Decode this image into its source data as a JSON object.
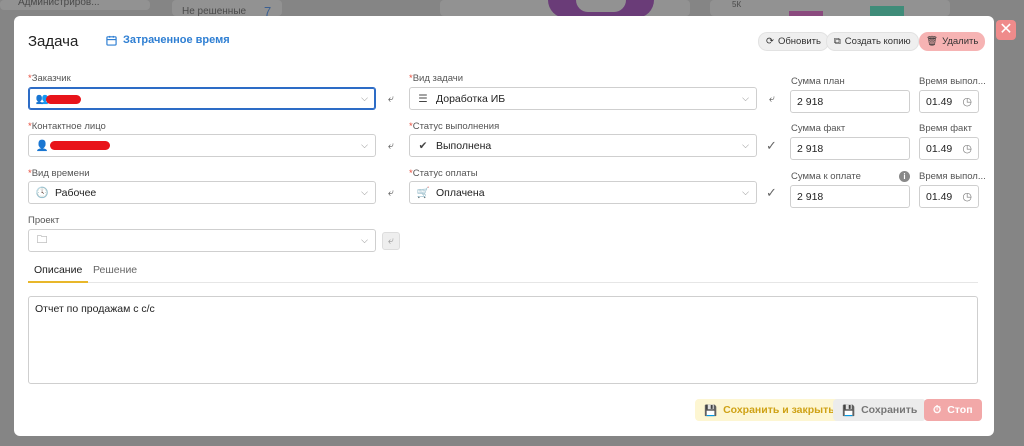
{
  "background": {
    "sidebar_item": "Администриров...",
    "stat_label": "Не решенные",
    "stat_value": "7",
    "chart_tick": "5К"
  },
  "modal": {
    "title": "Задача",
    "time_link": "Затраченное время",
    "buttons": {
      "refresh": "Обновить",
      "copy": "Создать копию",
      "delete": "Удалить"
    }
  },
  "form": {
    "customer": {
      "label": "Заказчик",
      "value": ""
    },
    "contact": {
      "label": "Контактное лицо",
      "value": ""
    },
    "time_type": {
      "label": "Вид времени",
      "value": "Рабочее"
    },
    "project": {
      "label": "Проект",
      "value": ""
    },
    "task_type": {
      "label": "Вид задачи",
      "value": "Доработка ИБ"
    },
    "exec_status": {
      "label": "Статус выполнения",
      "value": "Выполнена"
    },
    "pay_status": {
      "label": "Статус оплаты",
      "value": "Оплачена"
    },
    "sum_plan": {
      "label": "Сумма план",
      "value": "2 918"
    },
    "time_plan": {
      "label": "Время выпол...",
      "value": "01.49"
    },
    "sum_fact": {
      "label": "Сумма факт",
      "value": "2 918"
    },
    "time_fact": {
      "label": "Время факт",
      "value": "01.49"
    },
    "sum_pay": {
      "label": "Сумма к оплате",
      "value": "2 918"
    },
    "time_pay": {
      "label": "Время выпол...",
      "value": "01.49"
    }
  },
  "tabs": [
    "Описание",
    "Решение"
  ],
  "description": "Отчет по продажам с с/с",
  "footer": {
    "save_close": "Сохранить и закрыть",
    "save": "Сохранить",
    "stop": "Стоп"
  },
  "colors": {
    "accent_blue": "#2f7fd3",
    "required_red": "#e74c3c",
    "tab_underline": "#e8b72a",
    "delete_bg": "#f6b3b3"
  }
}
